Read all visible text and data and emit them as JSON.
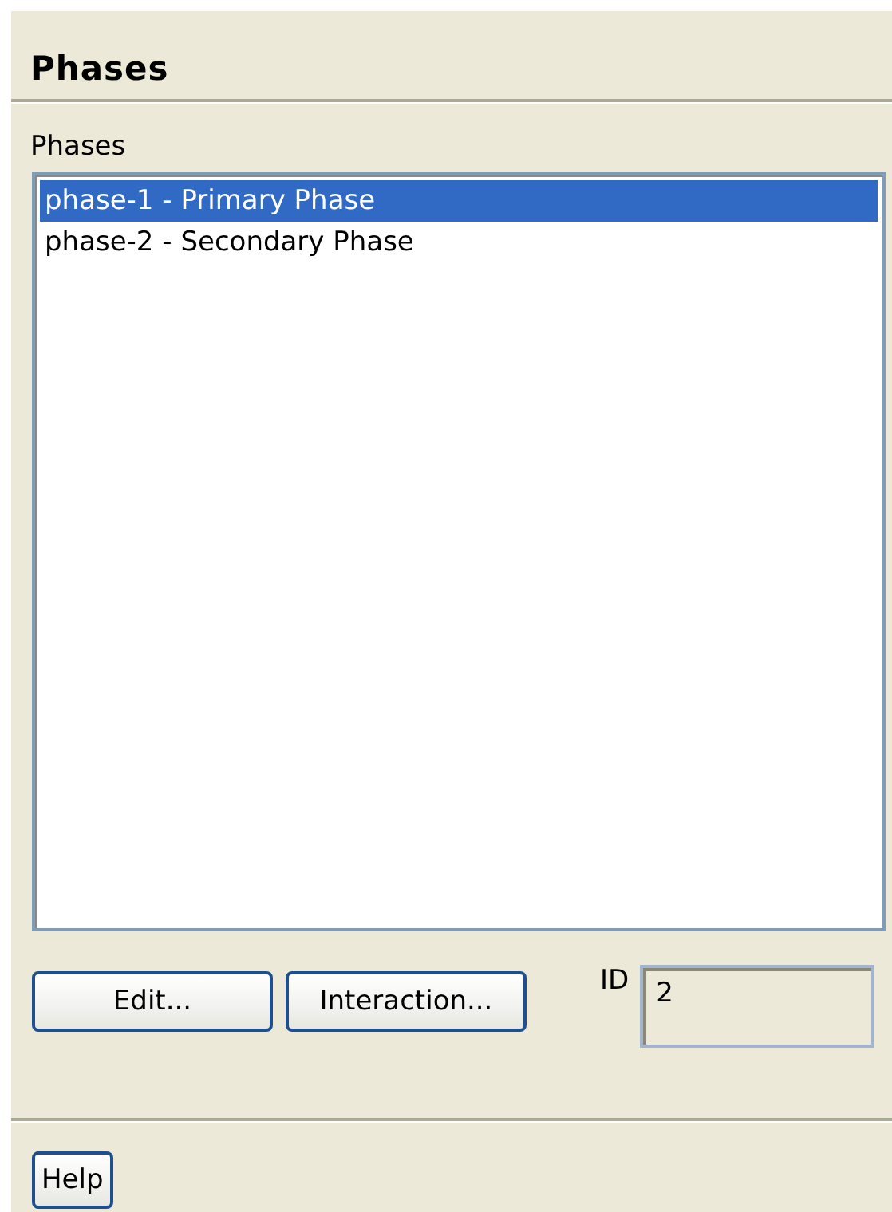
{
  "panel": {
    "title": "Phases"
  },
  "list": {
    "label": "Phases",
    "items": [
      {
        "text": "phase-1 - Primary Phase",
        "selected": true
      },
      {
        "text": "phase-2 - Secondary Phase",
        "selected": false
      }
    ]
  },
  "buttons": [
    "Edit...",
    "Interaction..."
  ],
  "id_field": {
    "label": "ID",
    "value": "2"
  },
  "footer_buttons": [
    "Help"
  ]
}
